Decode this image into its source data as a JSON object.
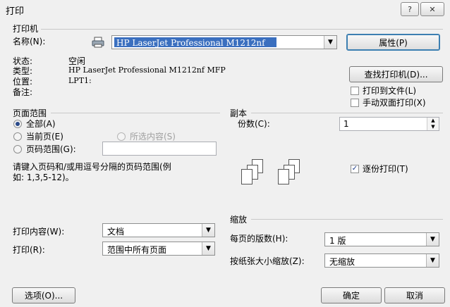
{
  "window": {
    "title": "打印",
    "help_label": "?",
    "close_label": "✕"
  },
  "printer": {
    "group_label": "打印机",
    "name_label": "名称(N):",
    "name_value": "HP LaserJet Professional M1212nf",
    "properties_button": "属性(P)",
    "status_label": "状态:",
    "status_value": "空闲",
    "type_label": "类型:",
    "type_value": "HP LaserJet Professional M1212nf MFP",
    "location_label": "位置:",
    "location_value": "LPT1:",
    "comment_label": "备注:",
    "find_button": "查找打印机(D)...",
    "print_to_file": "打印到文件(L)",
    "manual_duplex": "手动双面打印(X)"
  },
  "page_range": {
    "group_label": "页面范围",
    "all": "全部(A)",
    "current": "当前页(E)",
    "selection": "所选内容(S)",
    "pages": "页码范围(G):",
    "hint_line1": "请键入页码和/或用逗号分隔的页码范围(例",
    "hint_line2": "如: 1,3,5-12)。"
  },
  "copies": {
    "group_label": "副本",
    "count_label": "份数(C):",
    "count_value": "1",
    "collate": "逐份打印(T)"
  },
  "print_what": {
    "label": "打印内容(W):",
    "value": "文档"
  },
  "print": {
    "label": "打印(R):",
    "value": "范围中所有页面"
  },
  "zoom": {
    "group_label": "缩放",
    "pages_per_sheet_label": "每页的版数(H):",
    "pages_per_sheet_value": "1 版",
    "scale_label": "按纸张大小缩放(Z):",
    "scale_value": "无缩放"
  },
  "footer": {
    "options": "选项(O)...",
    "ok": "确定",
    "cancel": "取消"
  }
}
